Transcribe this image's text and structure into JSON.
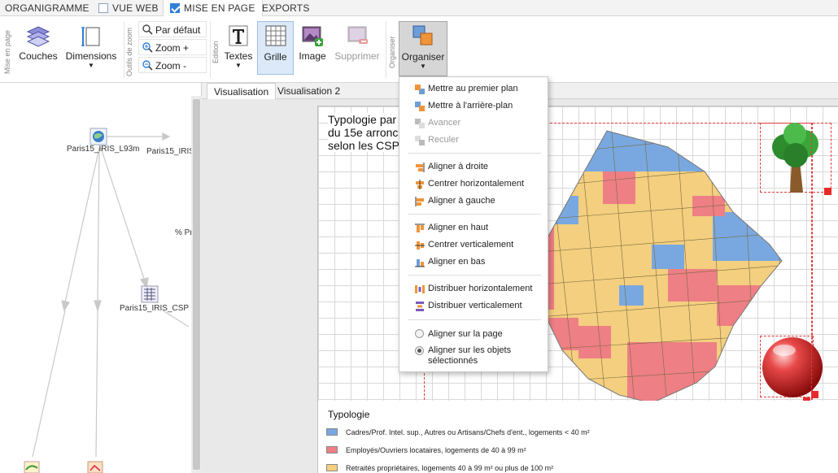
{
  "tabs": [
    {
      "label": "ORGANIGRAMME",
      "checkbox": null,
      "active": false
    },
    {
      "label": "VUE WEB",
      "checkbox": false,
      "active": false
    },
    {
      "label": "MISE EN PAGE",
      "checkbox": true,
      "active": true
    },
    {
      "label": "EXPORTS",
      "checkbox": null,
      "active": false
    }
  ],
  "ribbon": {
    "groups": {
      "mise_en_page": "Mise en page",
      "outils_zoom": "Outils de zoom",
      "edition": "Edition",
      "organiser": "Organiser"
    },
    "couches": "Couches",
    "dimensions": "Dimensions",
    "par_defaut": "Par défaut",
    "zoom_plus": "Zoom +",
    "zoom_moins": "Zoom -",
    "textes": "Textes",
    "grille": "Grille",
    "image": "Image",
    "supprimer": "Supprimer",
    "organiser": "Organiser"
  },
  "left_panel": {
    "nodes": {
      "l93m": "Paris15_IRIS_L93m",
      "secondary": "Paris15_IRIS_",
      "csp": "Paris15_IRIS_CSP",
      "percent": "% Pr"
    }
  },
  "vis_tabs": [
    "Visualisation",
    "Visualisation 2"
  ],
  "map": {
    "title_lines": [
      "Typologie par",
      "du 15e arronc",
      "selon les CSP"
    ],
    "legend_title": "Typologie",
    "legend": [
      {
        "label": "Cadres/Prof. Intel. sup., Autres ou Artisans/Chefs d'ent., logements < 40 m²",
        "color": "#79a8e0"
      },
      {
        "label": "Employés/Ouvriers locataires, logements de 40 à 99 m²",
        "color": "#ee7f85"
      },
      {
        "label": "Retraités propriétaires, logements 40 à 99 m² ou plus de 100 m²",
        "color": "#f3cf7f"
      }
    ]
  },
  "menu": {
    "items": [
      {
        "label": "Mettre au premier plan",
        "disabled": false
      },
      {
        "label": "Mettre à l'arrière-plan",
        "disabled": false
      },
      {
        "label": "Avancer",
        "disabled": true
      },
      {
        "label": "Reculer",
        "disabled": true
      },
      {
        "label": "Aligner à droite",
        "disabled": false
      },
      {
        "label": "Centrer horizontalement",
        "disabled": false
      },
      {
        "label": "Aligner à gauche",
        "disabled": false
      },
      {
        "label": "Aligner en haut",
        "disabled": false
      },
      {
        "label": "Centrer verticalement",
        "disabled": false
      },
      {
        "label": "Aligner en bas",
        "disabled": false
      },
      {
        "label": "Distribuer horizontalement",
        "disabled": false
      },
      {
        "label": "Distribuer verticalement",
        "disabled": false
      }
    ],
    "radio": [
      {
        "label": "Aligner sur la page",
        "checked": false
      },
      {
        "label": "Aligner sur les objets sélectionnés",
        "checked": true
      }
    ]
  },
  "colors": {
    "accent": "#2f7fd8",
    "selection": "#e23a3a",
    "blue": "#79a8e0",
    "red": "#ee7f85",
    "yellow": "#f3cf7f"
  }
}
